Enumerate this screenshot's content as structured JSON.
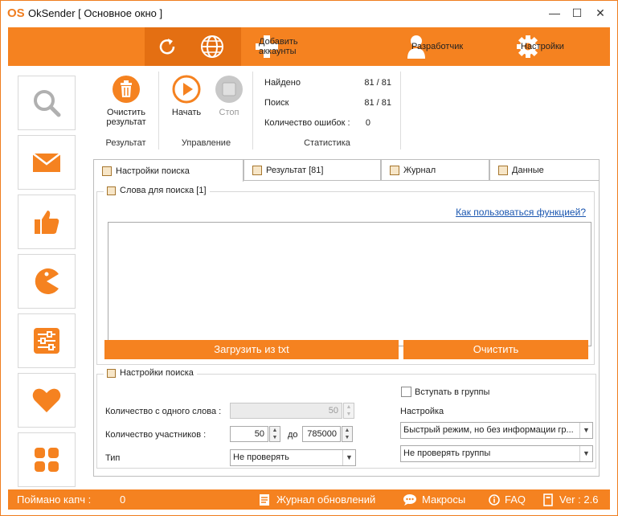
{
  "window": {
    "title": "OkSender [ Основное окно ]",
    "logo_text": "OS",
    "minimize_glyph": "—",
    "maximize_glyph": "☐",
    "close_glyph": "✕"
  },
  "toolbar": {
    "refresh_icon": "refresh-icon",
    "globe_icon": "globe-icon",
    "add_accounts_label": "Добавить аккаунты",
    "developer_label": "Разработчик",
    "settings_label": "Настройки"
  },
  "leftnav": {
    "items": [
      "search-icon",
      "mail-icon",
      "thumbs-up-icon",
      "pacman-icon",
      "sliders-icon",
      "heart-icon",
      "grid-icon"
    ]
  },
  "ribbon": {
    "clear_label_1": "Очистить",
    "clear_label_2": "результат",
    "result_caption": "Результат",
    "start_label": "Начать",
    "stop_label": "Стоп",
    "control_caption": "Управление",
    "found_label": "Найдено",
    "found_value": "81 / 81",
    "search_label": "Поиск",
    "search_value": "81 / 81",
    "errors_label": "Количество ошибок :",
    "errors_value": "0",
    "stats_caption": "Статистика"
  },
  "tabs": [
    {
      "label": "Настройки поиска",
      "active": true
    },
    {
      "label": "Результат [81]",
      "active": false
    },
    {
      "label": "Журнал",
      "active": false
    },
    {
      "label": "Данные",
      "active": false
    }
  ],
  "words": {
    "title": "Слова для поиска [1]",
    "help_link": "Как пользоваться функцией?",
    "load_button": "Загрузить из txt",
    "clear_button": "Очистить"
  },
  "search_settings": {
    "title": "Настройки поиска",
    "per_word_label": "Количество  с одного слова :",
    "per_word_value": "50",
    "members_label": "Количество участников :",
    "members_from": "50",
    "members_to_label": "до",
    "members_to": "785000",
    "type_label": "Тип",
    "type_value": "Не проверять",
    "join_groups_label": "Вступать в группы",
    "join_groups_checked": false,
    "setting_label": "Настройка",
    "mode_value": "Быстрый режим, но без информации  гр...",
    "check_groups_value": "Не проверять группы"
  },
  "statusbar": {
    "captchas_label": "Поймано капч :",
    "captchas_value": "0",
    "changelog_label": "Журнал обновлений",
    "macros_label": "Макросы",
    "faq_label": "FAQ",
    "version_label": "Ver : 2.6"
  },
  "colors": {
    "accent": "#f58220",
    "accent_dark": "#e46f12",
    "stop_gray": "#c8c8c8"
  }
}
